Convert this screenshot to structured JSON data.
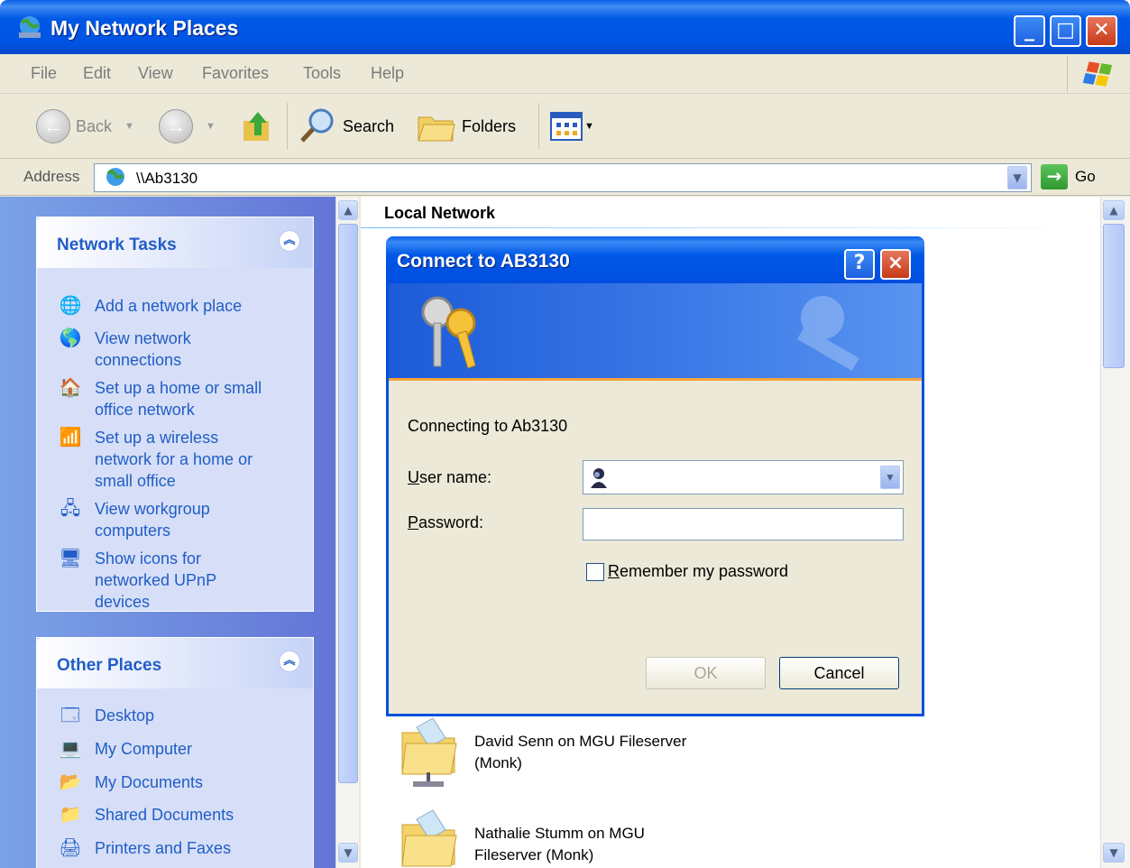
{
  "window": {
    "title": "My Network Places"
  },
  "menu": [
    "File",
    "Edit",
    "View",
    "Favorites",
    "Tools",
    "Help"
  ],
  "toolbar": {
    "back": "Back",
    "search": "Search",
    "folders": "Folders"
  },
  "address": {
    "label": "Address",
    "value": "\\\\Ab3130",
    "go": "Go"
  },
  "network_tasks": {
    "title": "Network Tasks",
    "items": [
      [
        "Add a network place"
      ],
      [
        "View network",
        "connections"
      ],
      [
        "Set up a home or small",
        "office network"
      ],
      [
        "Set up a wireless",
        "network for a home or",
        "small office"
      ],
      [
        "View workgroup",
        "computers"
      ],
      [
        "Show icons for",
        "networked UPnP",
        "devices"
      ]
    ]
  },
  "other_places": {
    "title": "Other Places",
    "items": [
      "Desktop",
      "My Computer",
      "My Documents",
      "Shared Documents",
      "Printers and Faxes"
    ]
  },
  "content": {
    "section": "Local Network",
    "shares": [
      [
        "David Senn on MGU Fileserver",
        "(Monk)"
      ],
      [
        "Nathalie Stumm on MGU",
        "Fileserver (Monk)"
      ]
    ]
  },
  "dialog": {
    "title": "Connect to AB3130",
    "connecting": "Connecting to Ab3130",
    "user_label_u": "U",
    "user_label_rest": "ser name:",
    "password_label_p": "P",
    "password_label_rest": "assword:",
    "remember_r": "R",
    "remember_rest": "emember my password",
    "remember_checked": false,
    "ok": "OK",
    "cancel": "Cancel",
    "help": "?",
    "close": "×"
  }
}
